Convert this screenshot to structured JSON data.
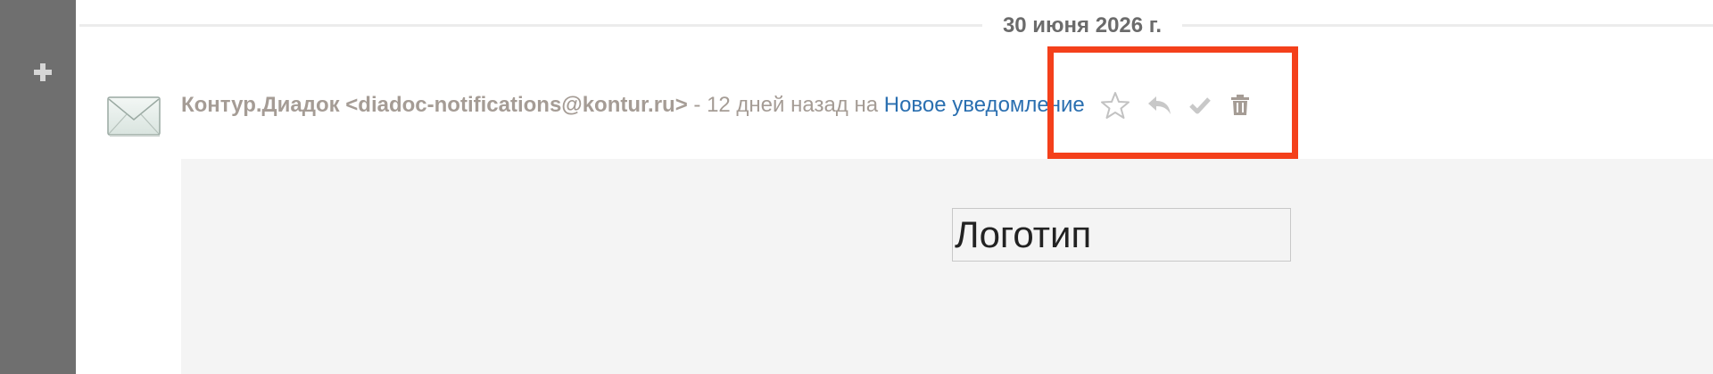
{
  "sidebar": {
    "add_icon": "plus-icon",
    "color": "#6f6f6f"
  },
  "date_separator": {
    "label": "30 июня 2026 г."
  },
  "message": {
    "icon": "envelope-icon",
    "sender": "Контур.Диадок <diadoc-notifications@kontur.ru>",
    "meta": " - 12 дней назад на ",
    "subject": "Новое уведомление",
    "actions": [
      {
        "name": "star-icon"
      },
      {
        "name": "reply-icon"
      },
      {
        "name": "check-icon"
      },
      {
        "name": "trash-icon"
      }
    ],
    "body": {
      "logo_placeholder": "Логотип"
    }
  },
  "colors": {
    "highlight": "#f4401b",
    "link": "#2a6fb0",
    "meta_text": "#a59c95",
    "body_bg": "#f4f4f4"
  }
}
